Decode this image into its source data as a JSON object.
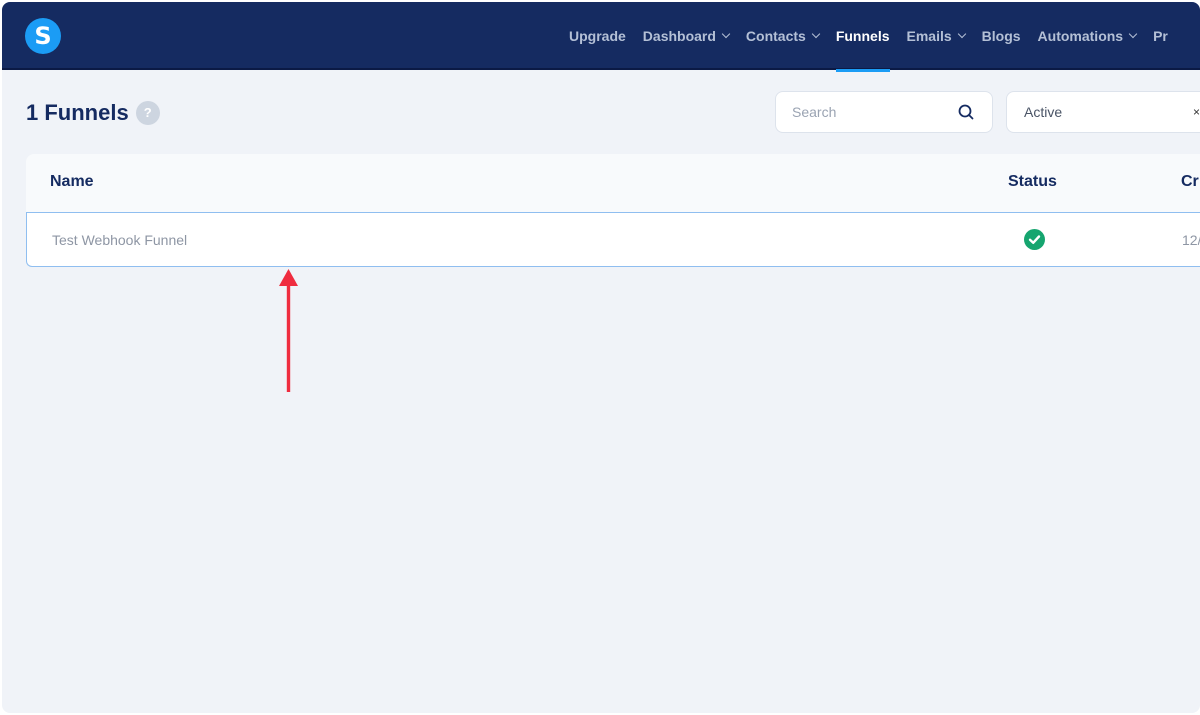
{
  "app": {
    "logo_letter": "S"
  },
  "nav": {
    "items": [
      {
        "label": "Upgrade",
        "dropdown": false,
        "active": false
      },
      {
        "label": "Dashboard",
        "dropdown": true,
        "active": false
      },
      {
        "label": "Contacts",
        "dropdown": true,
        "active": false
      },
      {
        "label": "Funnels",
        "dropdown": false,
        "active": true
      },
      {
        "label": "Emails",
        "dropdown": true,
        "active": false
      },
      {
        "label": "Blogs",
        "dropdown": false,
        "active": false
      },
      {
        "label": "Automations",
        "dropdown": true,
        "active": false
      },
      {
        "label": "Pr",
        "dropdown": false,
        "active": false
      }
    ]
  },
  "page": {
    "title": "1 Funnels",
    "help_icon": "?",
    "search_placeholder": "Search",
    "status_filter": "Active",
    "status_clear": "×"
  },
  "table": {
    "columns": [
      "Name",
      "Status",
      "Cr"
    ],
    "rows": [
      {
        "name": "Test Webhook Funnel",
        "status": "active",
        "created": "12/"
      }
    ]
  },
  "colors": {
    "topbar": "#152b61",
    "accent": "#1b9cf5",
    "success": "#16a56f",
    "annotation_arrow": "#ef2c3f"
  }
}
